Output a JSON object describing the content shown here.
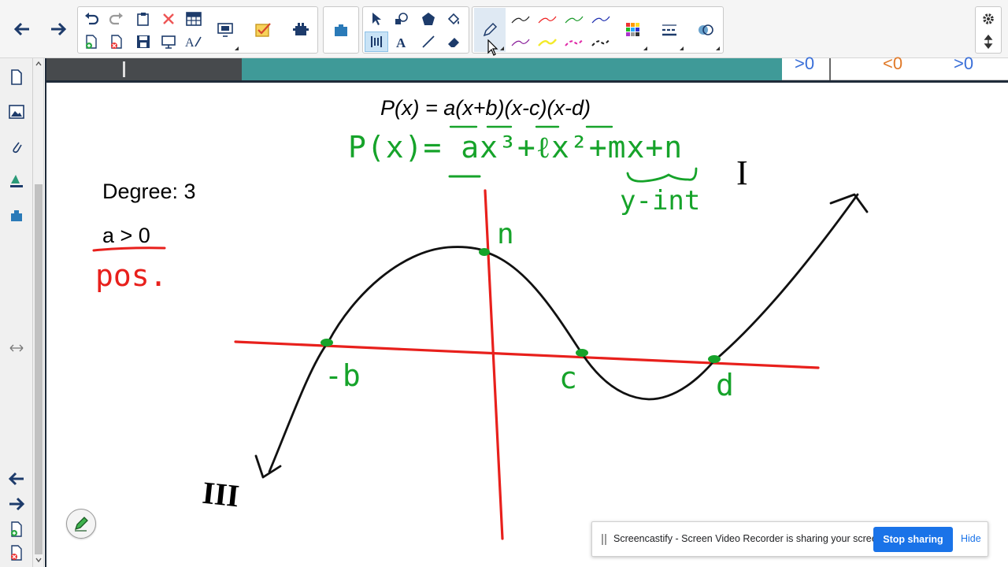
{
  "canvas": {
    "formula_typed": "P(x) = a(x+b)(x-c)(x-d)",
    "formula_handwritten": "P(x)= ax³+ℓx²+mx+n",
    "y_int_label": "y-int",
    "quadrant_1": "I",
    "quadrant_3": "III",
    "degree_label": "Degree: 3",
    "a_condition": "a > 0",
    "pos_label": "pos.",
    "point_n": "n",
    "point_neg_b": "-b",
    "point_c": "c",
    "point_d": "d",
    "prev_strip_left": ">0",
    "prev_strip_mid": "<0",
    "prev_strip_right": ">0"
  },
  "share_bar": {
    "message": "Screencastify - Screen Video Recorder is sharing your screen.",
    "stop_label": "Stop sharing",
    "hide_label": "Hide"
  },
  "icons": {
    "back": "back-arrow-icon",
    "forward": "forward-arrow-icon",
    "pen": "pen-icon",
    "settings": "gear-icon"
  },
  "colors": {
    "red_ink": "#e8201c",
    "green_ink": "#16a32a",
    "black_ink": "#111111",
    "teal_strip": "#3f9a98",
    "accent": "#1a73e8"
  }
}
